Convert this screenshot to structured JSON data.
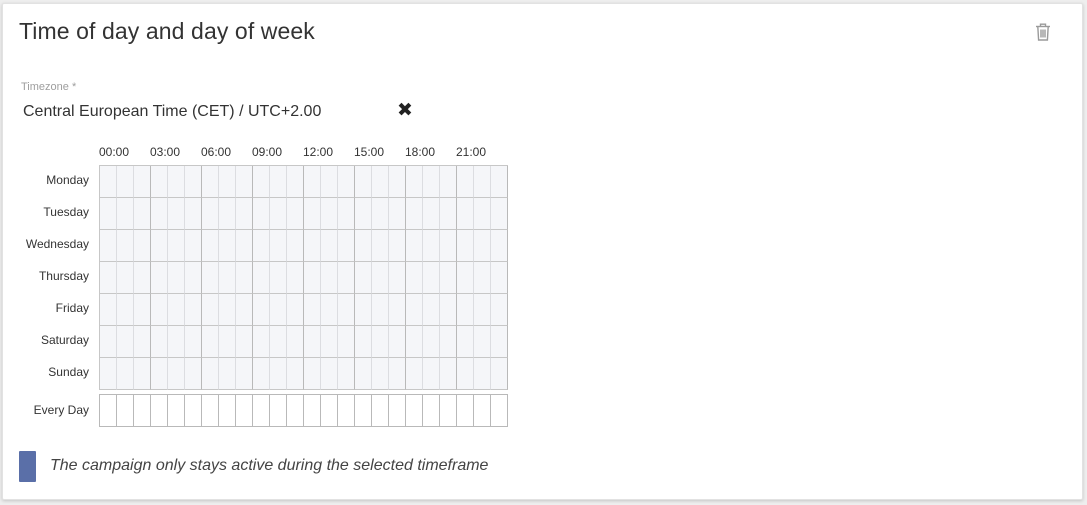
{
  "section": {
    "title": "Time of day and day of week",
    "delete_icon": "trash-icon"
  },
  "timezone": {
    "label": "Timezone *",
    "value": "Central European Time (CET) / UTC+2.00",
    "clear_icon": "close-x-icon"
  },
  "schedule": {
    "hour_labels": [
      "00:00",
      "03:00",
      "06:00",
      "09:00",
      "12:00",
      "15:00",
      "18:00",
      "21:00"
    ],
    "days": [
      "Monday",
      "Tuesday",
      "Wednesday",
      "Thursday",
      "Friday",
      "Saturday",
      "Sunday"
    ],
    "every_day_label": "Every Day",
    "selected_cells": []
  },
  "legend": {
    "text": "The campaign only stays active during the selected timeframe",
    "color": "#5a6fa8"
  },
  "colors": {
    "cell_background": "#f5f6f9",
    "grid_line": "#c7c7c7",
    "selected": "#5a6fa8"
  }
}
